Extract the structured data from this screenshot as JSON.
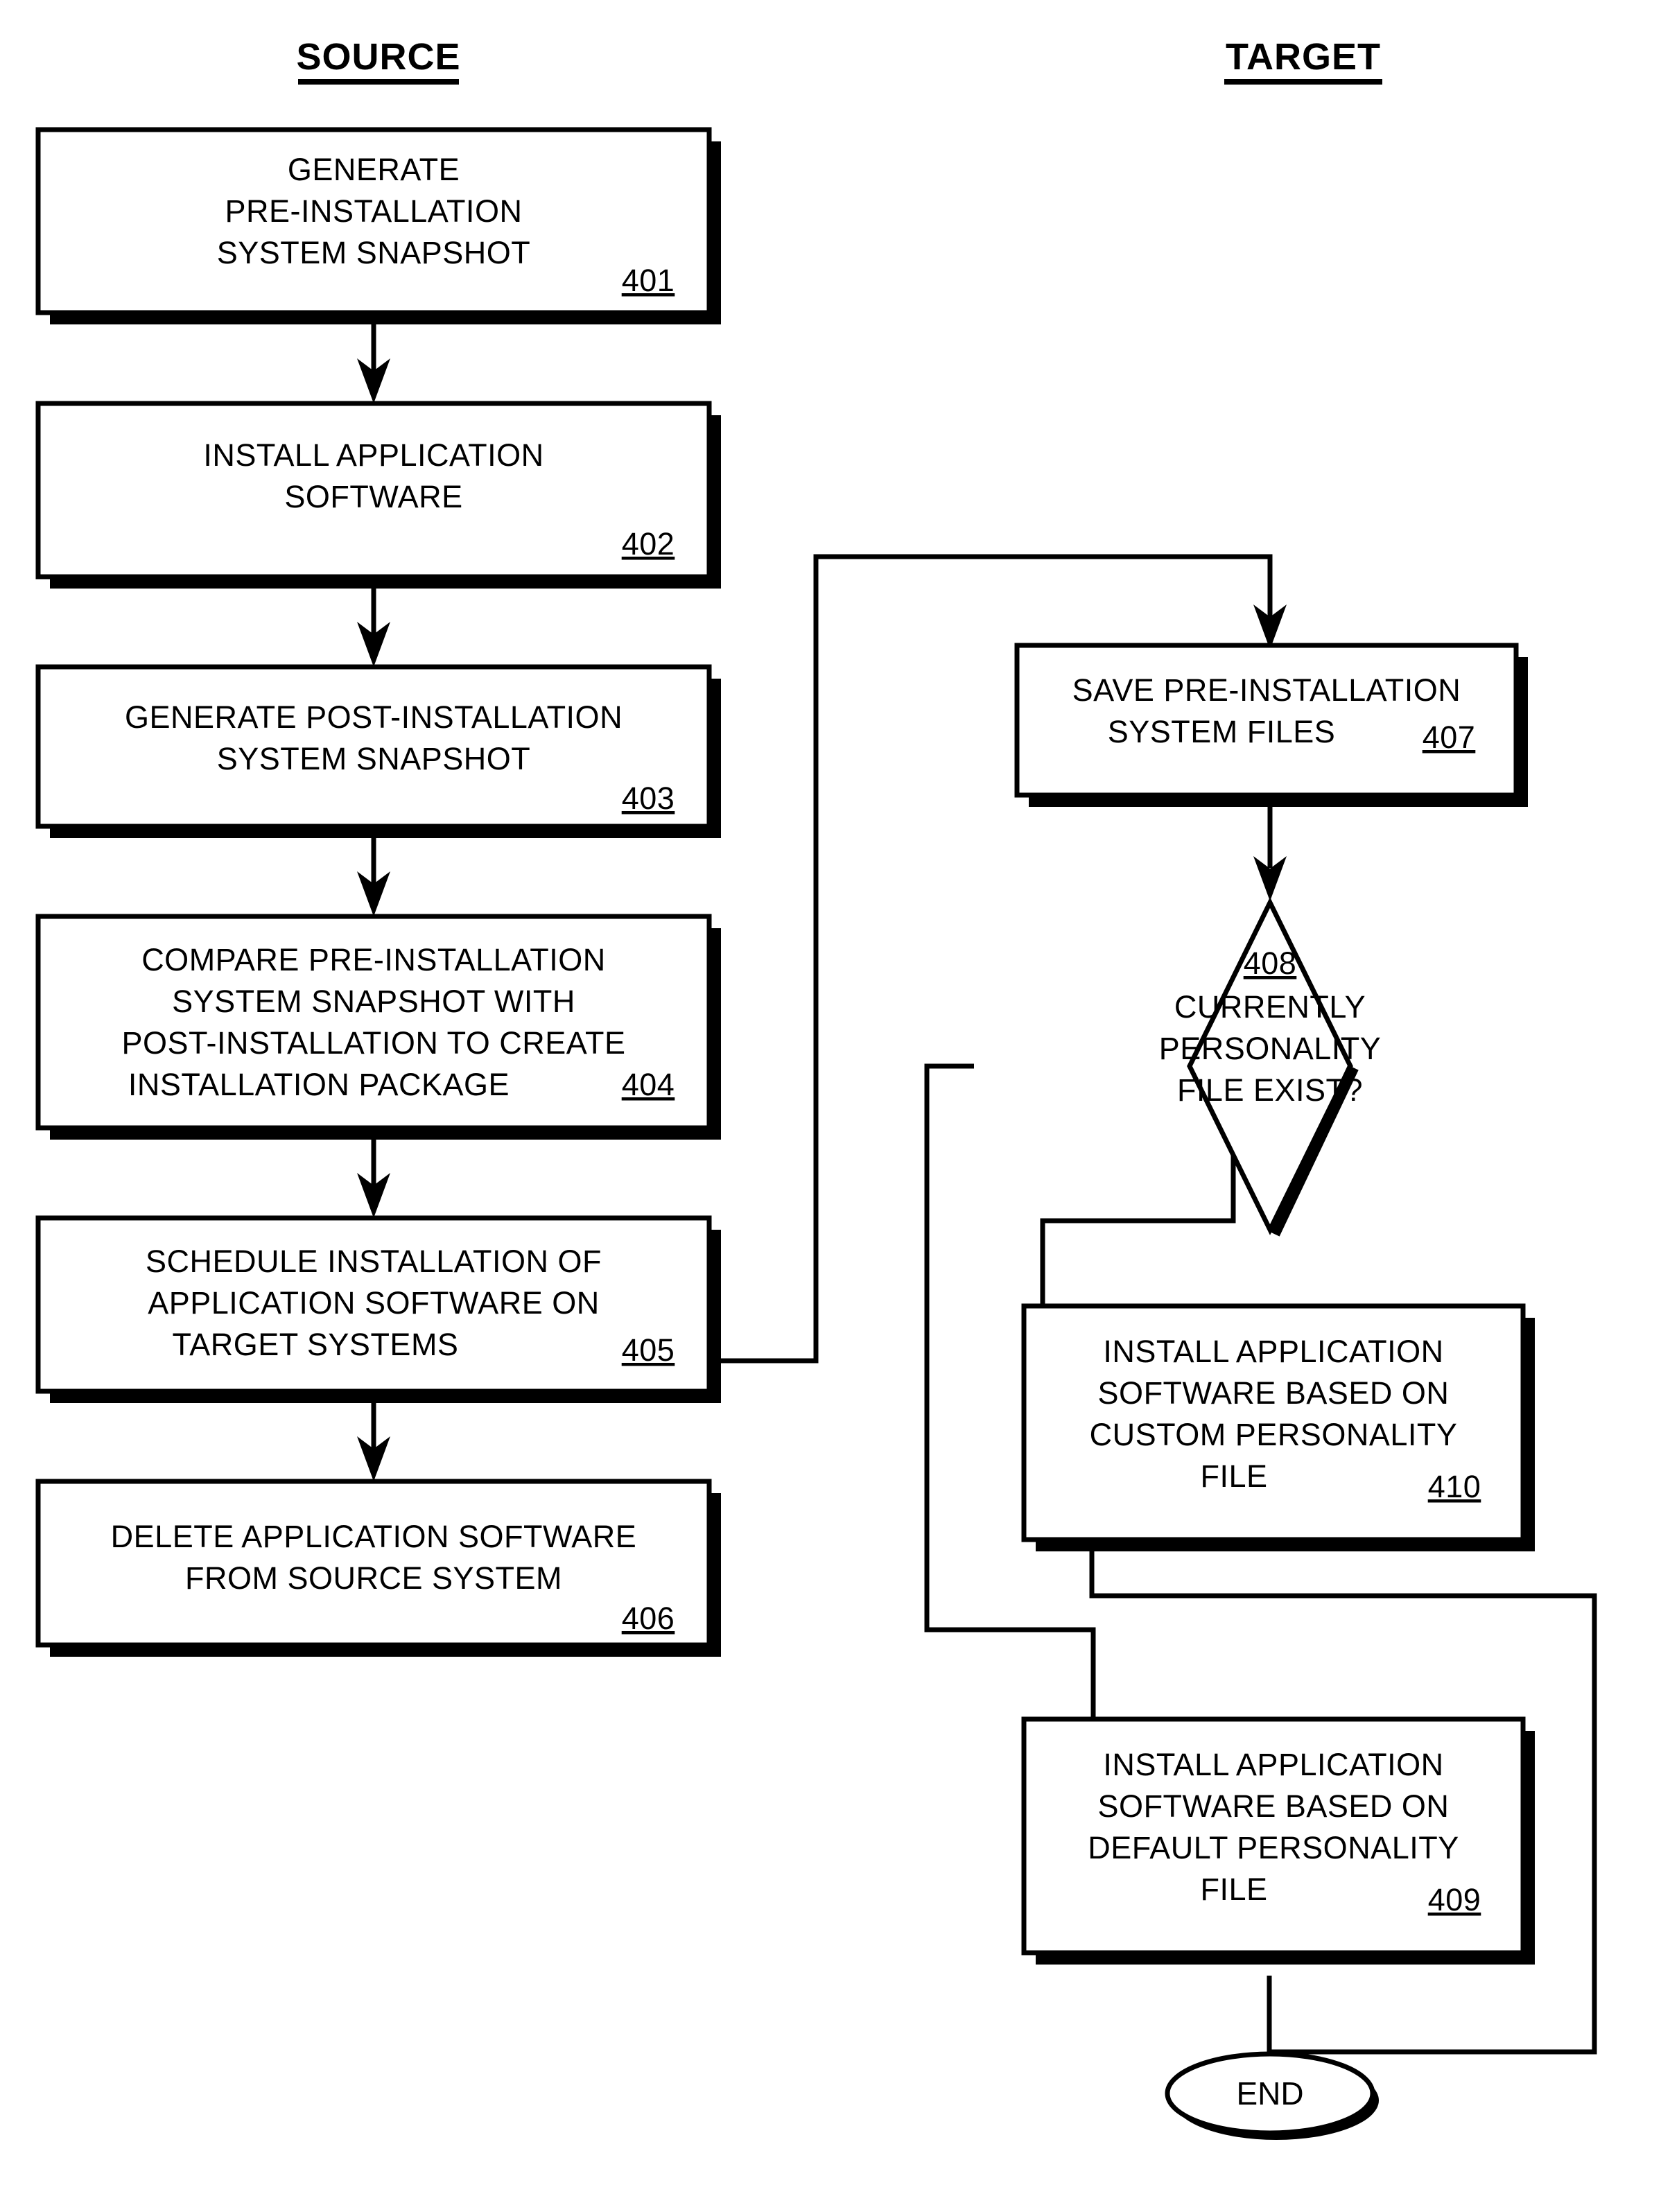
{
  "figure": {
    "type": "flowchart",
    "title": "",
    "columns": [
      {
        "id": "source",
        "label": "SOURCE"
      },
      {
        "id": "target",
        "label": "TARGET"
      }
    ],
    "nodes": [
      {
        "id": "n401",
        "column": "source",
        "shape": "process",
        "ref": "401",
        "lines": [
          "GENERATE",
          "PRE-INSTALLATION",
          "SYSTEM SNAPSHOT"
        ],
        "ref_inline": false
      },
      {
        "id": "n402",
        "column": "source",
        "shape": "process",
        "ref": "402",
        "lines": [
          "INSTALL APPLICATION",
          "SOFTWARE"
        ],
        "ref_inline": false
      },
      {
        "id": "n403",
        "column": "source",
        "shape": "process",
        "ref": "403",
        "lines": [
          "GENERATE POST-INSTALLATION",
          "SYSTEM SNAPSHOT"
        ],
        "ref_inline": false
      },
      {
        "id": "n404",
        "column": "source",
        "shape": "process",
        "ref": "404",
        "lines": [
          "COMPARE PRE-INSTALLATION",
          "SYSTEM SNAPSHOT WITH",
          "POST-INSTALLATION TO CREATE",
          "INSTALLATION PACKAGE"
        ],
        "ref_inline": true
      },
      {
        "id": "n405",
        "column": "source",
        "shape": "process",
        "ref": "405",
        "lines": [
          "SCHEDULE INSTALLATION OF",
          "APPLICATION SOFTWARE ON",
          "TARGET SYSTEMS"
        ],
        "ref_inline": true
      },
      {
        "id": "n406",
        "column": "source",
        "shape": "process",
        "ref": "406",
        "lines": [
          "DELETE APPLICATION SOFTWARE",
          "FROM SOURCE SYSTEM"
        ],
        "ref_inline": false
      },
      {
        "id": "n407",
        "column": "target",
        "shape": "process",
        "ref": "407",
        "lines": [
          "SAVE PRE-INSTALLATION",
          "SYSTEM FILES"
        ],
        "ref_inline": true
      },
      {
        "id": "n408",
        "column": "target",
        "shape": "decision",
        "ref": "408",
        "lines": [
          "CURRENTLY",
          "PERSONALITY",
          "FILE EXIST?"
        ],
        "ref_inline": false
      },
      {
        "id": "n410",
        "column": "target",
        "shape": "process",
        "ref": "410",
        "lines": [
          "INSTALL APPLICATION",
          "SOFTWARE BASED ON",
          "CUSTOM PERSONALITY",
          "FILE"
        ],
        "ref_inline": true
      },
      {
        "id": "n409",
        "column": "target",
        "shape": "process",
        "ref": "409",
        "lines": [
          "INSTALL APPLICATION",
          "SOFTWARE BASED ON",
          "DEFAULT PERSONALITY",
          "FILE"
        ],
        "ref_inline": true
      },
      {
        "id": "nend",
        "column": "target",
        "shape": "terminator",
        "ref": "",
        "lines": [
          "END"
        ],
        "ref_inline": false
      }
    ],
    "text": {
      "header_source": "SOURCE",
      "header_target": "TARGET",
      "n401_l1": "GENERATE",
      "n401_l2": "PRE-INSTALLATION",
      "n401_l3": "SYSTEM SNAPSHOT",
      "n401_ref": "401",
      "n402_l1": "INSTALL APPLICATION",
      "n402_l2": "SOFTWARE",
      "n402_ref": "402",
      "n403_l1": "GENERATE POST-INSTALLATION",
      "n403_l2": "SYSTEM SNAPSHOT",
      "n403_ref": "403",
      "n404_l1": "COMPARE PRE-INSTALLATION",
      "n404_l2": "SYSTEM SNAPSHOT WITH",
      "n404_l3": "POST-INSTALLATION TO CREATE",
      "n404_l4": "INSTALLATION PACKAGE",
      "n404_ref": "404",
      "n405_l1": "SCHEDULE INSTALLATION OF",
      "n405_l2": "APPLICATION SOFTWARE ON",
      "n405_l3": "TARGET SYSTEMS",
      "n405_ref": "405",
      "n406_l1": "DELETE APPLICATION SOFTWARE",
      "n406_l2": "FROM SOURCE SYSTEM",
      "n406_ref": "406",
      "n407_l1": "SAVE PRE-INSTALLATION",
      "n407_l2": "SYSTEM FILES",
      "n407_ref": "407",
      "n408_ref": "408",
      "n408_l1": "CURRENTLY",
      "n408_l2": "PERSONALITY",
      "n408_l3": "FILE EXIST?",
      "n410_l1": "INSTALL APPLICATION",
      "n410_l2": "SOFTWARE BASED ON",
      "n410_l3": "CUSTOM PERSONALITY",
      "n410_l4": "FILE",
      "n410_ref": "410",
      "n409_l1": "INSTALL APPLICATION",
      "n409_l2": "SOFTWARE BASED ON",
      "n409_l3": "DEFAULT PERSONALITY",
      "n409_l4": "FILE",
      "n409_ref": "409",
      "nend_label": "END"
    },
    "edges": [
      {
        "from": "n401",
        "to": "n402",
        "kind": "straight-down"
      },
      {
        "from": "n402",
        "to": "n403",
        "kind": "straight-down"
      },
      {
        "from": "n403",
        "to": "n404",
        "kind": "straight-down"
      },
      {
        "from": "n404",
        "to": "n405",
        "kind": "straight-down"
      },
      {
        "from": "n405",
        "to": "n406",
        "kind": "straight-down"
      },
      {
        "from": "n405",
        "to": "n407",
        "kind": "right-up-right-down"
      },
      {
        "from": "n407",
        "to": "n408",
        "kind": "straight-down"
      },
      {
        "from": "n408",
        "to": "n410",
        "kind": "right-branch"
      },
      {
        "from": "n408",
        "to": "n409",
        "kind": "left-branch"
      },
      {
        "from": "n410",
        "to": "nend",
        "kind": "right-down"
      },
      {
        "from": "n409",
        "to": "nend",
        "kind": "straight-down"
      }
    ],
    "colors": {
      "ink": "#000000",
      "paper": "#ffffff"
    }
  }
}
